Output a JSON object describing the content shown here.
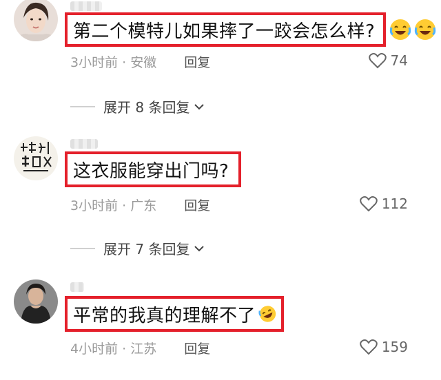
{
  "comments": [
    {
      "text": "第二个模特儿如果摔了一跤会怎么样?",
      "time_location": "3小时前 · 安徽",
      "reply_label": "回复",
      "likes": "74",
      "avatar_icon": "woman-avatar",
      "emoji": "laughing-crying-emoji"
    },
    {
      "text": "这衣服能穿出门吗?",
      "time_location": "3小时前 · 广东",
      "reply_label": "回复",
      "likes": "112",
      "avatar_icon": "calligraphy-avatar"
    },
    {
      "text": "平常的我真的理解不了",
      "time_location": "4小时前 · 江苏",
      "reply_label": "回复",
      "likes": "159",
      "avatar_icon": "woman-avatar",
      "emoji": "rofl-emoji"
    }
  ],
  "expand": [
    {
      "label": "展开 8 条回复"
    },
    {
      "label": "展开 7 条回复"
    }
  ],
  "colors": {
    "highlight_border": "#e4202b",
    "meta_text": "#9a9a9a"
  }
}
